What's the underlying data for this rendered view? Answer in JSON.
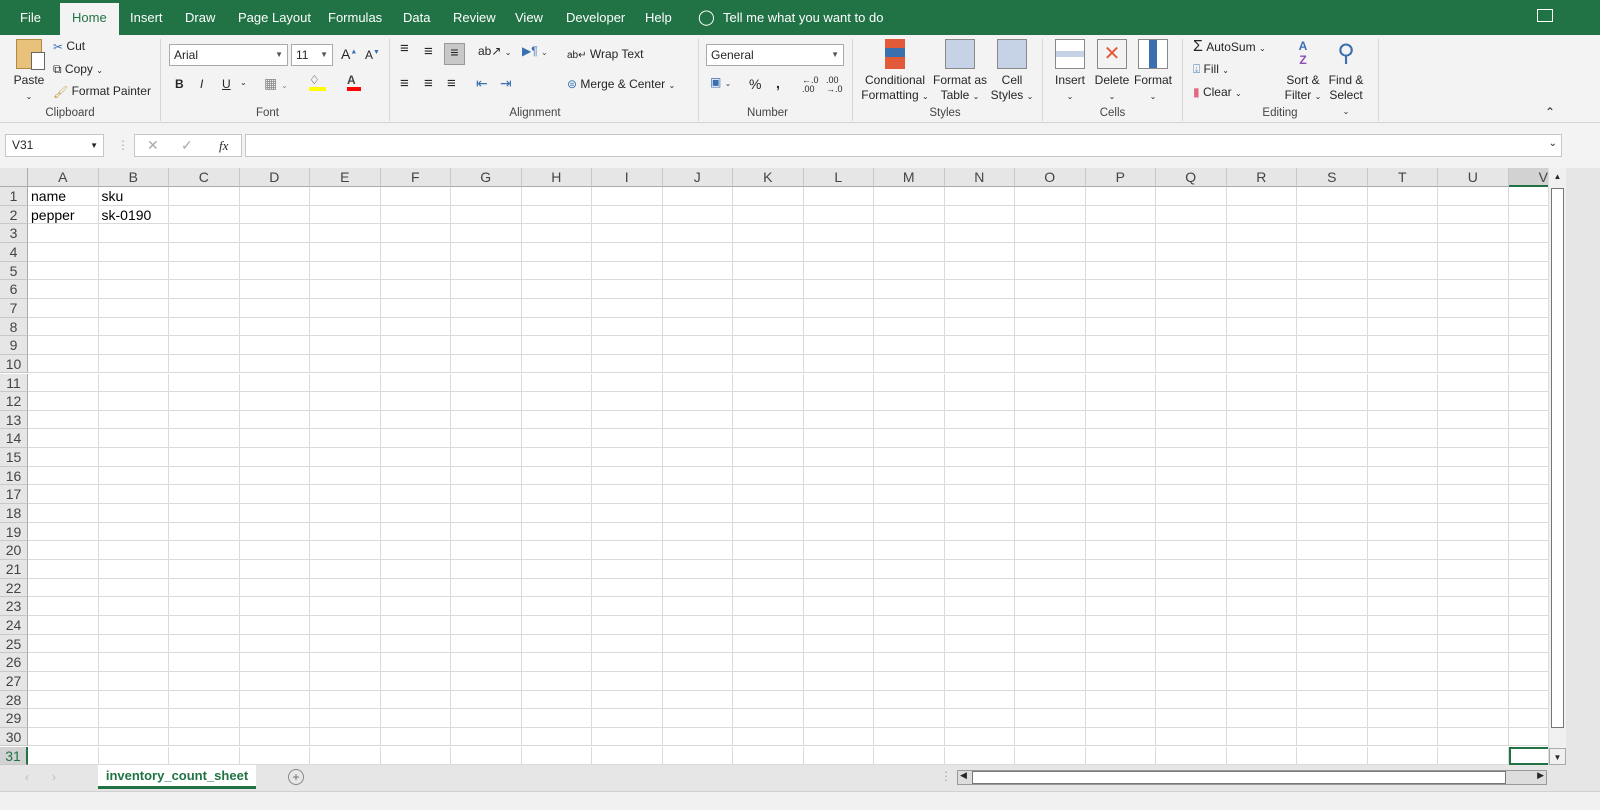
{
  "menu": {
    "tabs": [
      "File",
      "Home",
      "Insert",
      "Draw",
      "Page Layout",
      "Formulas",
      "Data",
      "Review",
      "View",
      "Developer",
      "Help"
    ],
    "active": "Home",
    "tell_me": "Tell me what you want to do"
  },
  "clipboard": {
    "paste": "Paste",
    "cut": "Cut",
    "copy": "Copy",
    "format_painter": "Format Painter",
    "label": "Clipboard"
  },
  "font": {
    "name": "Arial",
    "size": "11",
    "bold": "B",
    "italic": "I",
    "underline": "U",
    "label": "Font",
    "fill_color": "#ffff00",
    "font_color": "#ff0000"
  },
  "alignment": {
    "wrap_text": "Wrap Text",
    "merge_center": "Merge & Center",
    "label": "Alignment"
  },
  "number": {
    "format": "General",
    "percent": "%",
    "comma": ",",
    "label": "Number"
  },
  "styles": {
    "conditional": [
      "Conditional",
      "Formatting"
    ],
    "format_table": [
      "Format as",
      "Table"
    ],
    "cell_styles": [
      "Cell",
      "Styles"
    ],
    "label": "Styles"
  },
  "cells": {
    "insert": "Insert",
    "delete": "Delete",
    "format": "Format",
    "label": "Cells"
  },
  "editing": {
    "autosum": "AutoSum",
    "fill": "Fill",
    "clear": "Clear",
    "sort": [
      "Sort &",
      "Filter"
    ],
    "find": [
      "Find &",
      "Select"
    ],
    "label": "Editing"
  },
  "formula_bar": {
    "name_box": "V31",
    "fx": "fx",
    "value": ""
  },
  "sheet": {
    "columns": [
      "A",
      "B",
      "C",
      "D",
      "E",
      "F",
      "G",
      "H",
      "I",
      "J",
      "K",
      "L",
      "M",
      "N",
      "O",
      "P",
      "Q",
      "R",
      "S",
      "T",
      "U",
      "V"
    ],
    "row_count": 31,
    "selected_cell": "V31",
    "cells": {
      "A1": "name",
      "B1": "sku",
      "A2": "pepper",
      "B2": "sk-0190"
    }
  },
  "sheet_tabs": {
    "active": "inventory_count_sheet"
  },
  "colors": {
    "brand": "#217346"
  }
}
